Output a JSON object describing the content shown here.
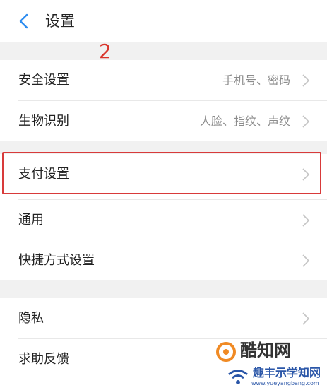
{
  "header": {
    "title": "设置"
  },
  "annotation": {
    "step_number": "2"
  },
  "group1": [
    {
      "label": "安全设置",
      "value": "手机号、密码"
    },
    {
      "label": "生物识别",
      "value": "人脸、指纹、声纹"
    }
  ],
  "group2": [
    {
      "label": "支付设置",
      "value": ""
    },
    {
      "label": "通用",
      "value": ""
    },
    {
      "label": "快捷方式设置",
      "value": ""
    }
  ],
  "group3": [
    {
      "label": "隐私",
      "value": ""
    },
    {
      "label": "求助反馈",
      "value": ""
    }
  ],
  "watermark": {
    "site1": "酷知网",
    "site2": "趣丰示学知网",
    "site2_url": "www.yueyangbang.com"
  },
  "colors": {
    "annotation_red": "#d83a3a",
    "back_arrow": "#2d8cf0",
    "background_gap": "#f1f1f1"
  }
}
